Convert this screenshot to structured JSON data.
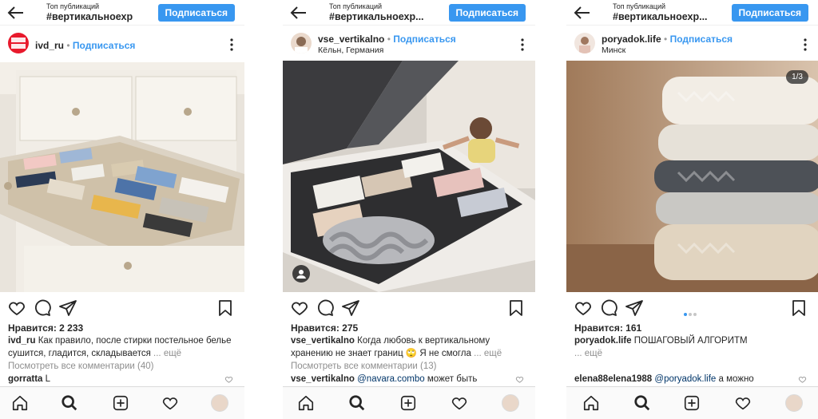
{
  "posts": [
    {
      "topbar": {
        "small": "Топ публикаций",
        "tag": "#вертикальноехр",
        "follow": "Подписаться"
      },
      "user": "ivd_ru",
      "follow_link": "Подписаться",
      "location": "",
      "avatar_text": "ИДЕИ ДОМА",
      "likes": "Нравится: 2 233",
      "caption_user": "ivd_ru",
      "caption": "Как правило, после стирки постельное белье сушится, гладится, складывается",
      "more": "... ещё",
      "view_comments": "Посмотреть все комментарии (40)",
      "comment_user": "gorratta",
      "comment_text": "L",
      "comment_mention": "",
      "comment_rest": ""
    },
    {
      "topbar": {
        "small": "Топ публикаций",
        "tag": "#вертикальноехр...",
        "follow": "Подписаться"
      },
      "user": "vse_vertikalno",
      "follow_link": "Подписаться",
      "location": "Кёльн, Германия",
      "likes": "Нравится: 275",
      "caption_user": "vse_vertikalno",
      "caption": "Когда любовь к вертикальному хранению не знает границ 🙄 Я не смогла",
      "more": "... ещё",
      "view_comments": "Посмотреть все комментарии (13)",
      "comment_user": "vse_vertikalno",
      "comment_text": "",
      "comment_mention": "@navara.combo",
      "comment_rest": "может быть"
    },
    {
      "topbar": {
        "small": "Топ публикаций",
        "tag": "#вертикальноехр...",
        "follow": "Подписаться"
      },
      "user": "poryadok.life",
      "follow_link": "Подписаться",
      "location": "Минск",
      "carousel": "1/3",
      "likes": "Нравится: 161",
      "caption_user": "poryadok.life",
      "caption": "ПОШАГОВЫЙ АЛГОРИТМ",
      "more": "... ещё",
      "view_comments": "",
      "comment_user": "elena88elena1988",
      "comment_text": "",
      "comment_mention": "@poryadok.life",
      "comment_rest": "а можно"
    }
  ],
  "colors": {
    "accent": "#3897f0",
    "text": "#262626",
    "muted": "#8e8e8e"
  },
  "icons": [
    "back-arrow-icon",
    "more-icon",
    "heart-icon",
    "comment-icon",
    "share-icon",
    "bookmark-icon",
    "home-icon",
    "search-icon",
    "add-icon",
    "activity-heart-icon"
  ]
}
